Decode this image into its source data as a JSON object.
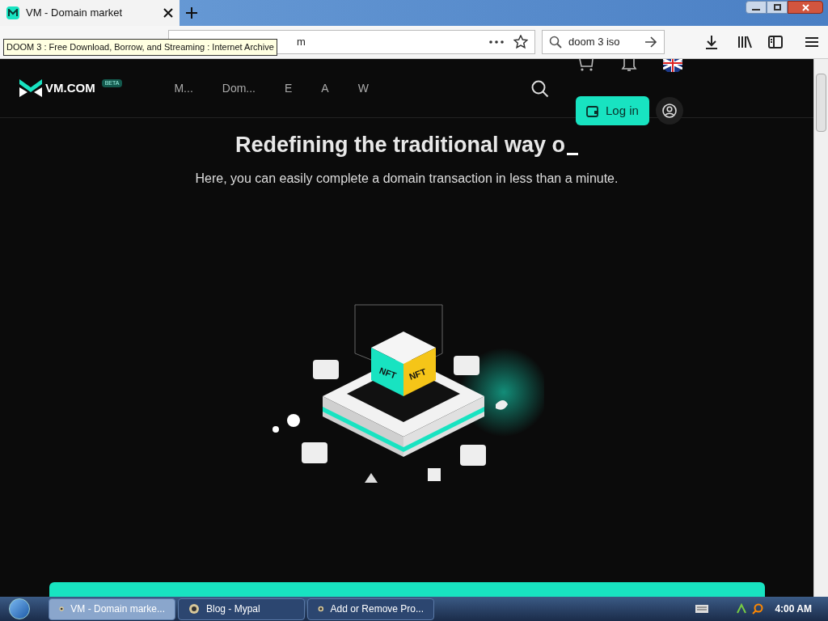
{
  "browser": {
    "tab": {
      "title": "VM - Domain market",
      "selected": true
    },
    "address_fragment": "m",
    "search_value": "doom 3 iso",
    "tooltip": "DOOM 3 : Free Download, Borrow, and Streaming : Internet Archive"
  },
  "site": {
    "logo": "VM.COM",
    "badge": "BETA",
    "nav": [
      "M...",
      "Dom...",
      "E",
      "A",
      "W"
    ],
    "login": "Log in"
  },
  "hero": {
    "title": "Redefining the traditional way o",
    "subtitle": "Here, you can easily complete a domain transaction in less than a minute.",
    "cube_labels": [
      "NFT",
      "NFT"
    ]
  },
  "taskbar": {
    "items": [
      {
        "label": "VM - Domain marke...",
        "selected": true
      },
      {
        "label": "Blog - Mypal",
        "selected": false
      },
      {
        "label": "Add or Remove Pro...",
        "selected": false
      }
    ],
    "clock": "4:00 AM"
  }
}
